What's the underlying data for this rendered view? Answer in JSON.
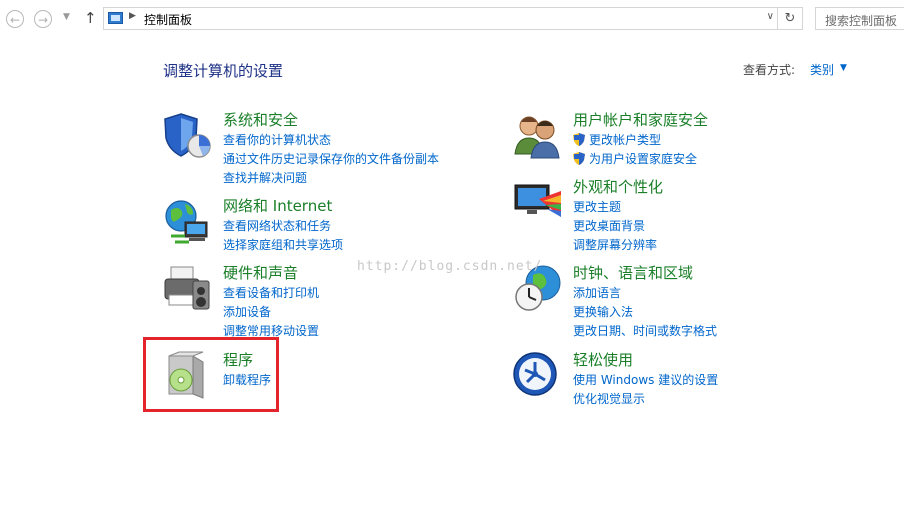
{
  "address_bar": {
    "path": "控制面板",
    "search_placeholder": "搜索控制面板"
  },
  "header": {
    "title": "调整计算机的设置",
    "view_by_label": "查看方式:",
    "view_by_value": "类别"
  },
  "categories_left": [
    {
      "title": "系统和安全",
      "links": [
        "查看你的计算机状态",
        "通过文件历史记录保存你的文件备份副本",
        "查找并解决问题"
      ]
    },
    {
      "title": "网络和 Internet",
      "links": [
        "查看网络状态和任务",
        "选择家庭组和共享选项"
      ]
    },
    {
      "title": "硬件和声音",
      "links": [
        "查看设备和打印机",
        "添加设备",
        "调整常用移动设置"
      ]
    },
    {
      "title": "程序",
      "links": [
        "卸载程序"
      ]
    }
  ],
  "categories_right": [
    {
      "title": "用户帐户和家庭安全",
      "links": [
        "更改帐户类型",
        "为用户设置家庭安全"
      ]
    },
    {
      "title": "外观和个性化",
      "links": [
        "更改主题",
        "更改桌面背景",
        "调整屏幕分辨率"
      ]
    },
    {
      "title": "时钟、语言和区域",
      "links": [
        "添加语言",
        "更换输入法",
        "更改日期、时间或数字格式"
      ]
    },
    {
      "title": "轻松使用",
      "links": [
        "使用 Windows 建议的设置",
        "优化视觉显示"
      ]
    }
  ],
  "watermark": "http://blog.csdn.net/",
  "icons": {
    "back": "back-arrow-icon",
    "forward": "forward-arrow-icon",
    "up": "up-arrow-icon",
    "refresh": "refresh-icon"
  }
}
